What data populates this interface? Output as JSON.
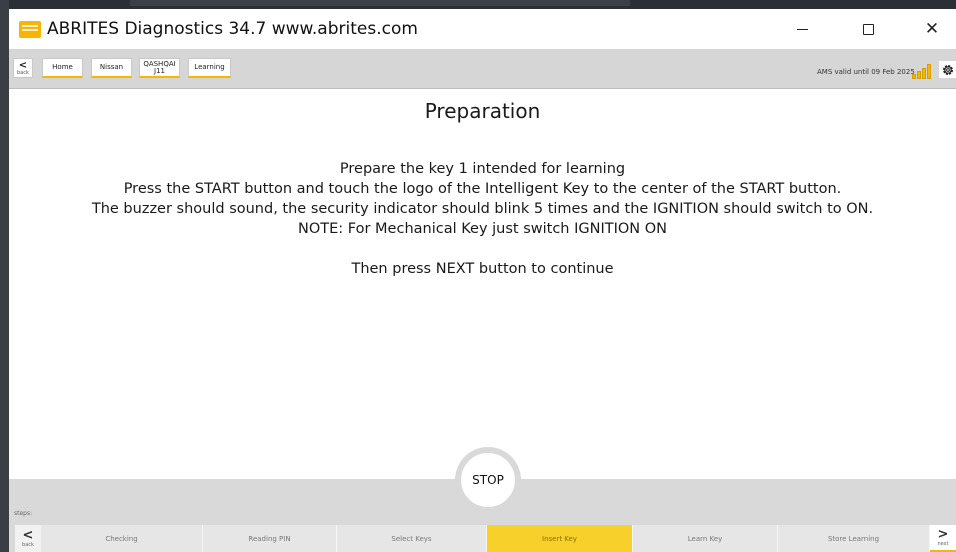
{
  "window": {
    "title": "ABRITES Diagnostics 34.7   www.abrites.com",
    "minimize": "minimize-icon",
    "maximize": "maximize-icon",
    "close_glyph": "✕"
  },
  "nav": {
    "back_label": "back",
    "breadcrumbs": [
      {
        "label": "Home"
      },
      {
        "label": "Nissan"
      },
      {
        "label": "QASHQAI J11"
      },
      {
        "label": "Learning"
      }
    ],
    "ams_status": "AMS valid until 09 Feb 2025",
    "signal_icon": "signal-bars-icon",
    "settings_icon": "gear-icon",
    "accent_color": "#f5b800"
  },
  "content": {
    "heading": "Preparation",
    "lines": [
      "Prepare the key 1 intended for learning",
      "Press the START button and touch the logo of the Intelligent Key to the center of the START button.",
      "The buzzer should sound, the security indicator should blink 5 times and the IGNITION should switch to ON.",
      "NOTE: For Mechanical Key just switch IGNITION ON"
    ],
    "continue_line": "Then press NEXT button to continue"
  },
  "stop_button": "STOP",
  "steps": {
    "label": "steps:",
    "back_label": "back",
    "next_label": "next",
    "items": [
      {
        "label": "Checking"
      },
      {
        "label": "Reading PIN"
      },
      {
        "label": "Select Keys"
      },
      {
        "label": "Insert Key"
      },
      {
        "label": "Learn Key"
      },
      {
        "label": "Store Learning"
      }
    ],
    "active_step": "Insert Key",
    "active_color": "#f7d02c"
  }
}
